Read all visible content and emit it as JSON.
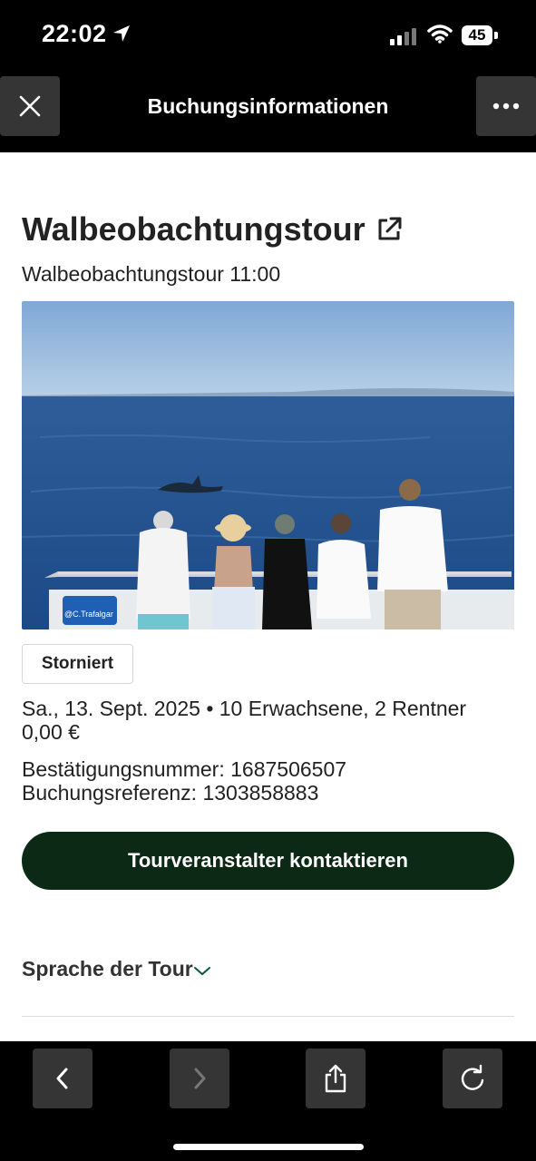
{
  "status_bar": {
    "time": "22:02",
    "battery": "45"
  },
  "header": {
    "title": "Buchungsinformationen",
    "close_icon": "close-icon",
    "more_icon": "more-dots-icon"
  },
  "booking": {
    "title": "Walbeobachtungstour",
    "subtitle": "Walbeobachtungstour 11:00",
    "photo_credit": "@C.Trafalgar",
    "status": "Storniert",
    "details_line": "Sa., 13. Sept. 2025 • 10 Erwachsene, 2 Rentner",
    "price": "0,00 €",
    "confirmation": "Bestätigungsnummer: 1687506507",
    "reference": "Buchungsreferenz: 1303858883",
    "contact_button": "Tourveranstalter kontaktieren",
    "language_section": "Sprache der Tour"
  },
  "colors": {
    "cta": "#0b2915",
    "button_bg": "#353535"
  },
  "toolbar": {
    "icons": [
      "back-icon",
      "forward-icon",
      "share-icon",
      "reload-icon"
    ]
  }
}
